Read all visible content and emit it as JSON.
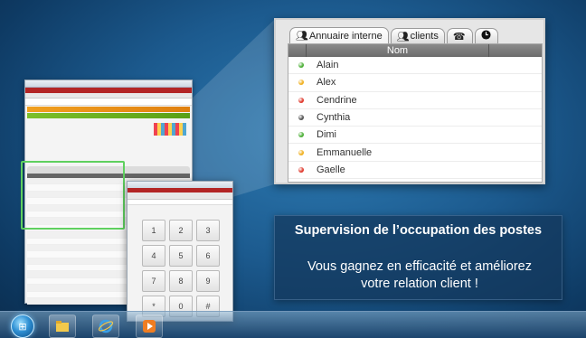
{
  "directory": {
    "tabs": [
      {
        "label": "Annuaire interne",
        "icon": "group-icon"
      },
      {
        "label": "clients",
        "icon": "group-icon"
      },
      {
        "label": "",
        "icon": "phone-icon"
      },
      {
        "label": "",
        "icon": "clock-icon"
      }
    ],
    "column_header": "Nom",
    "entries": [
      {
        "name": "Alain",
        "status_color": "#4caf37"
      },
      {
        "name": "Alex",
        "status_color": "#f0b020"
      },
      {
        "name": "Cendrine",
        "status_color": "#e03a2e"
      },
      {
        "name": "Cynthia",
        "status_color": "#555555"
      },
      {
        "name": "Dimi",
        "status_color": "#4caf37"
      },
      {
        "name": "Emmanuelle",
        "status_color": "#f0b020"
      },
      {
        "name": "Gaelle",
        "status_color": "#e03a2e"
      }
    ]
  },
  "dialpad": {
    "keys": [
      "1",
      "2",
      "3",
      "4",
      "5",
      "6",
      "7",
      "8",
      "9",
      "*",
      "0",
      "#"
    ]
  },
  "info": {
    "title": "Supervision de l’occupation des postes",
    "body_line1": "Vous gagnez en efficacité et améliorez",
    "body_line2": "votre relation client !"
  },
  "taskbar": {
    "items": [
      "start-orb",
      "file-explorer",
      "internet-explorer",
      "media-player"
    ]
  },
  "colors": {
    "highlight": "#5fd05f",
    "menu_red": "#b32525",
    "desktop": "#1c5a8e"
  }
}
